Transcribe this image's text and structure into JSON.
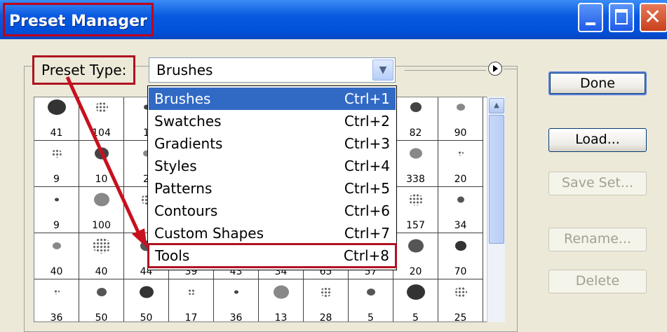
{
  "window": {
    "title": "Preset Manager"
  },
  "preset_type": {
    "label": "Preset Type:",
    "value": "Brushes"
  },
  "dropdown": {
    "items": [
      {
        "label": "Brushes",
        "shortcut": "Ctrl+1"
      },
      {
        "label": "Swatches",
        "shortcut": "Ctrl+2"
      },
      {
        "label": "Gradients",
        "shortcut": "Ctrl+3"
      },
      {
        "label": "Styles",
        "shortcut": "Ctrl+4"
      },
      {
        "label": "Patterns",
        "shortcut": "Ctrl+5"
      },
      {
        "label": "Contours",
        "shortcut": "Ctrl+6"
      },
      {
        "label": "Custom Shapes",
        "shortcut": "Ctrl+7"
      },
      {
        "label": "Tools",
        "shortcut": "Ctrl+8"
      }
    ]
  },
  "brushes": {
    "rows": [
      [
        "41",
        "104",
        "1",
        "",
        "",
        "",
        "",
        "",
        "82",
        "90"
      ],
      [
        "9",
        "10",
        "2",
        "",
        "",
        "",
        "",
        "",
        "338",
        "20"
      ],
      [
        "9",
        "100",
        "",
        "",
        "",
        "",
        "",
        "",
        "157",
        "34"
      ],
      [
        "40",
        "40",
        "44",
        "39",
        "43",
        "34",
        "65",
        "57",
        "20",
        "70"
      ],
      [
        "36",
        "50",
        "50",
        "17",
        "36",
        "13",
        "28",
        "5",
        "5",
        "25"
      ]
    ]
  },
  "buttons": {
    "done": "Done",
    "load": "Load...",
    "save_set": "Save Set...",
    "rename": "Rename...",
    "delete": "Delete"
  },
  "colors": {
    "highlight": "#316ac5",
    "annotation": "#b01020",
    "titlebar": "#0a5ae0"
  }
}
